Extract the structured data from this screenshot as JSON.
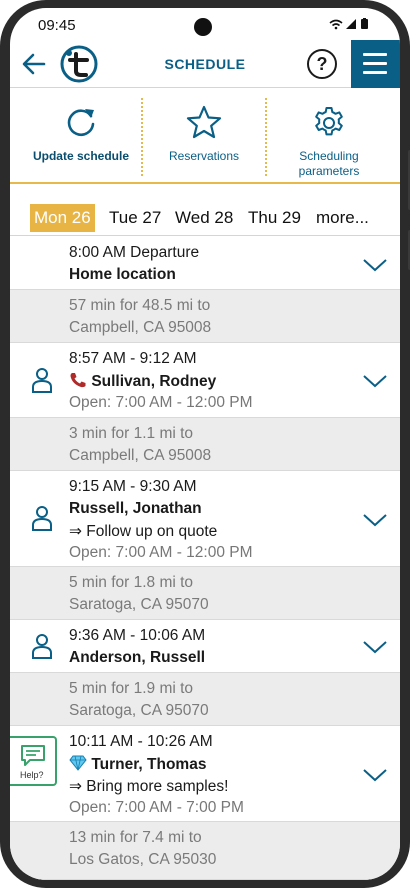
{
  "status_bar": {
    "time": "09:45",
    "icons": "wifi signal battery"
  },
  "header": {
    "title": "SCHEDULE",
    "help_label": "?"
  },
  "toolbar": {
    "update": "Update schedule",
    "reservations": "Reservations",
    "params_line1": "Scheduling",
    "params_line2": "parameters"
  },
  "days": [
    {
      "label": "Mon 26",
      "active": true
    },
    {
      "label": "Tue 27"
    },
    {
      "label": "Wed 28"
    },
    {
      "label": "Thu 29"
    },
    {
      "label": "more..."
    }
  ],
  "schedule": {
    "departure": {
      "time": "8:00 AM Departure",
      "place": "Home location"
    },
    "travel1": {
      "line1": "57 min for 48.5 mi to",
      "line2": "Campbell, CA 95008"
    },
    "appt1": {
      "time": "8:57 AM - 9:12 AM",
      "name": "Sullivan, Rodney",
      "open": "Open: 7:00 AM - 12:00 PM"
    },
    "travel2": {
      "line1": "3 min for 1.1 mi to",
      "line2": "Campbell, CA 95008"
    },
    "appt2": {
      "time": "9:15 AM - 9:30 AM",
      "name": "Russell, Jonathan",
      "note": "⇒ Follow up on quote",
      "open": "Open: 7:00 AM - 12:00 PM"
    },
    "travel3": {
      "line1": "5 min for 1.8 mi to",
      "line2": "Saratoga, CA 95070"
    },
    "appt3": {
      "time": "9:36 AM - 10:06 AM",
      "name": "Anderson, Russell"
    },
    "travel4": {
      "line1": "5 min for 1.9 mi to",
      "line2": "Saratoga, CA 95070"
    },
    "appt4": {
      "time": "10:11 AM - 10:26 AM",
      "name": "Turner, Thomas",
      "note": "⇒ Bring more samples!",
      "open": "Open: 7:00 AM - 7:00 PM"
    },
    "travel5": {
      "line1": "13 min for 7.4 mi to",
      "line2": "Los Gatos, CA 95030"
    }
  },
  "help_bubble": {
    "label": "Help?"
  },
  "colors": {
    "brand": "#0a5f86",
    "accent": "#e8b444",
    "help_green": "#39a26b"
  }
}
